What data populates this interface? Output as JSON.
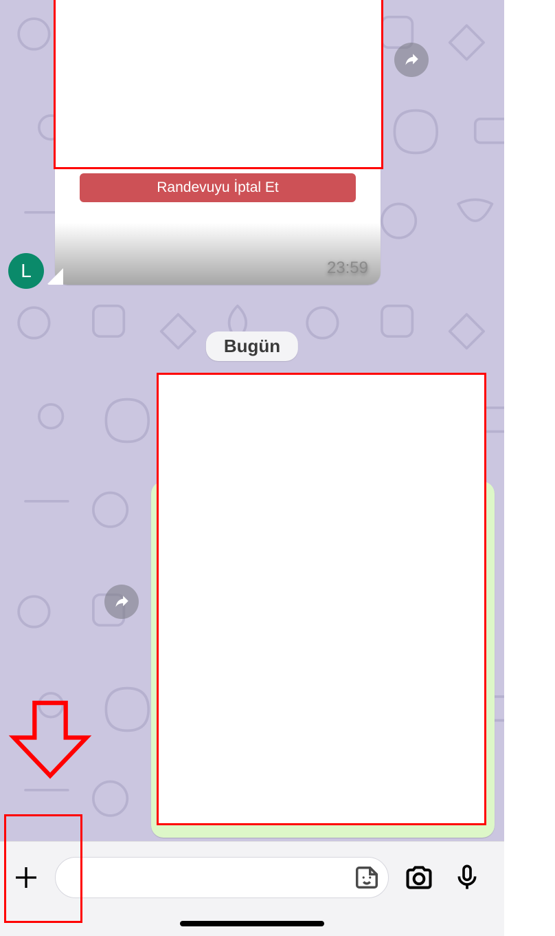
{
  "messages": {
    "incoming": {
      "cancel_button_label": "Randevuyu İptal Et",
      "time": "23:59",
      "avatar_letter": "L"
    }
  },
  "date_separator": "Bugün",
  "input": {
    "placeholder": ""
  },
  "icons": {
    "forward": "forward-icon",
    "plus": "plus-icon",
    "sticker": "sticker-icon",
    "camera": "camera-icon",
    "microphone": "microphone-icon"
  },
  "colors": {
    "chat_bg": "#cbc6e0",
    "bubble_in": "#ffffff",
    "bubble_out": "#ddf7c8",
    "cancel_btn": "#cd5156",
    "avatar": "#0a8a6a",
    "annotation": "#ff0000"
  }
}
